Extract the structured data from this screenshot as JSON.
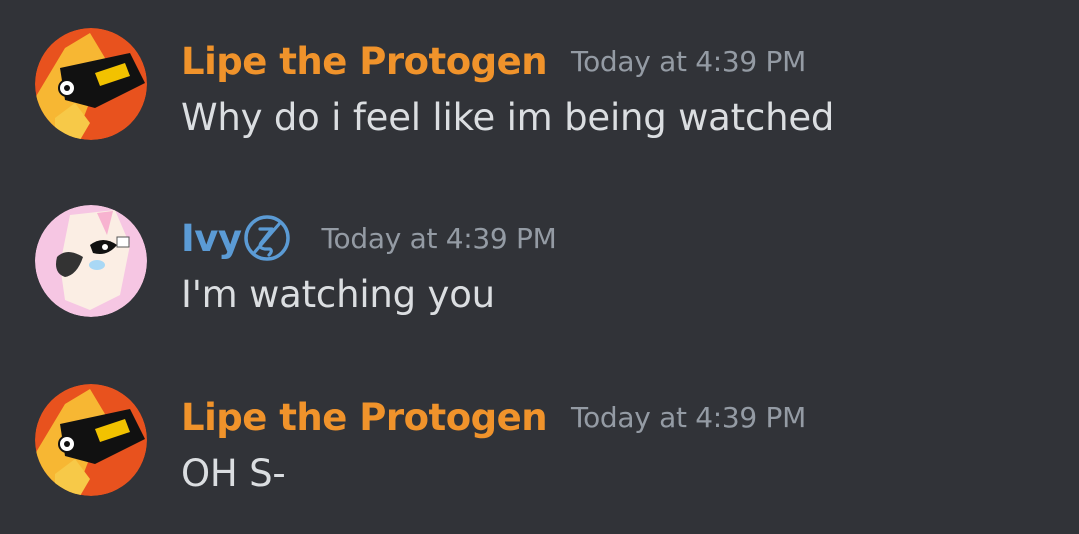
{
  "colors": {
    "background": "#313338",
    "lipe_name": "#f0932b",
    "ivy_name": "#5b9bd5",
    "timestamp": "#949ba4",
    "message_text": "#dbdee1"
  },
  "messages": [
    {
      "author": "Lipe the Protogen",
      "avatar_icon": "protogen-avatar-icon",
      "timestamp": "Today at 4:39 PM",
      "text": "Why do i feel like im being watched"
    },
    {
      "author": "Ivy",
      "avatar_icon": "fox-avatar-icon",
      "badge_icon": "zeta-badge-icon",
      "timestamp": "Today at 4:39 PM",
      "text": "I'm watching you"
    },
    {
      "author": "Lipe the Protogen",
      "avatar_icon": "protogen-avatar-icon",
      "timestamp": "Today at 4:39 PM",
      "text": "OH S-"
    }
  ]
}
